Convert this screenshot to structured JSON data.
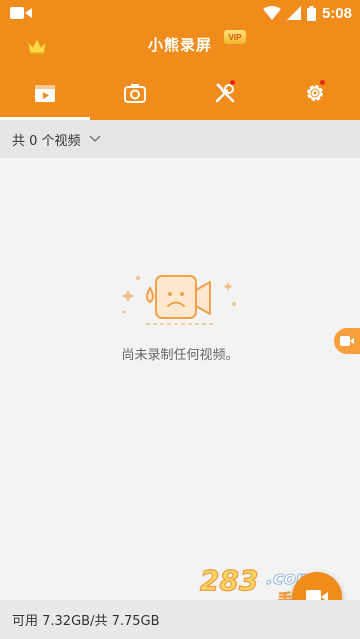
{
  "status_bar": {
    "time": "5:08",
    "icons": [
      "video-camera-icon",
      "wifi-icon",
      "signal-icon",
      "battery-icon"
    ]
  },
  "header": {
    "title": "小熊录屏",
    "vip_badge": "VIP",
    "icons": [
      "crown-icon"
    ]
  },
  "tabs": [
    {
      "icon": "video-list-icon",
      "active": true,
      "badge": false
    },
    {
      "icon": "camera-icon",
      "active": false,
      "badge": false
    },
    {
      "icon": "tools-icon",
      "active": false,
      "badge": true
    },
    {
      "icon": "settings-icon",
      "active": false,
      "badge": true
    }
  ],
  "filter": {
    "label": "共 0 个视频",
    "icon": "chevron-down-icon"
  },
  "empty_state": {
    "message": "尚未录制任何视频。",
    "icon": "sad-camera-icon"
  },
  "footer": {
    "storage": "可用 7.32GB/共 7.75GB"
  },
  "colors": {
    "brand": "#f08c1c",
    "badge": "#e8281e",
    "background": "#f3f3f3"
  }
}
